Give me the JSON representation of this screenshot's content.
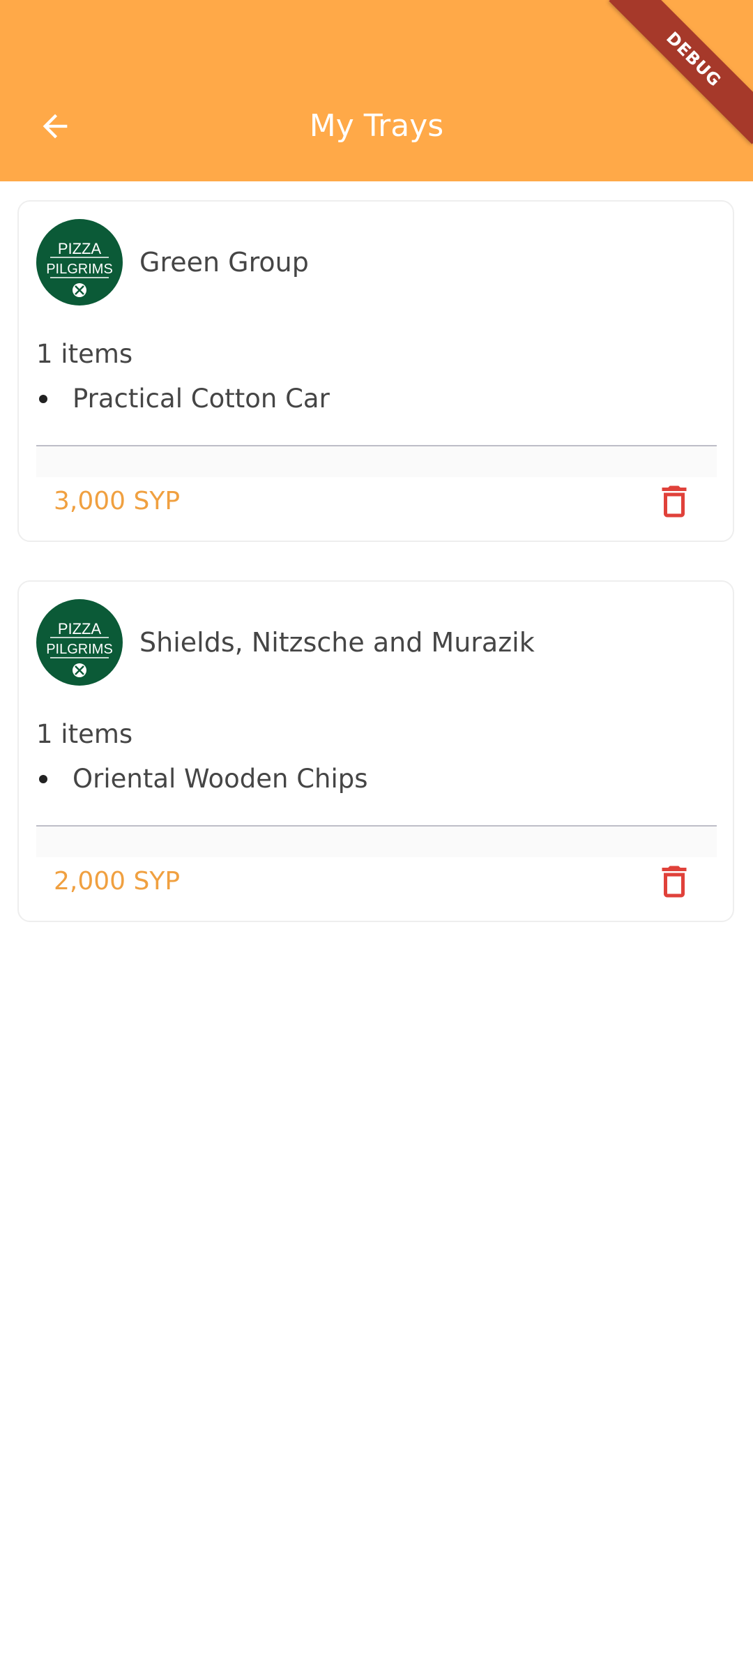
{
  "app_bar": {
    "title": "My Trays",
    "back_icon": "arrow-left-icon",
    "background_color": "#FFA948"
  },
  "debug_banner": {
    "label": "DEBUG",
    "color": "#A6392A"
  },
  "trays": [
    {
      "store_name": "Green Group",
      "logo_icon": "pizza-pilgrims-logo",
      "logo_text": [
        "PIZZA",
        "PILGRIMS"
      ],
      "items_count": "1 items",
      "items": [
        "Practical Cotton Car"
      ],
      "price": "3,000 SYP",
      "delete_icon": "trash-icon"
    },
    {
      "store_name": "Shields, Nitzsche and Murazik",
      "logo_icon": "pizza-pilgrims-logo",
      "logo_text": [
        "PIZZA",
        "PILGRIMS"
      ],
      "items_count": "1 items",
      "items": [
        "Oriental Wooden Chips"
      ],
      "price": "2,000 SYP",
      "delete_icon": "trash-icon"
    }
  ],
  "colors": {
    "accent": "#FFA948",
    "price": "#F0A040",
    "delete": "#E0413A",
    "logo_green": "#0B5A37"
  }
}
